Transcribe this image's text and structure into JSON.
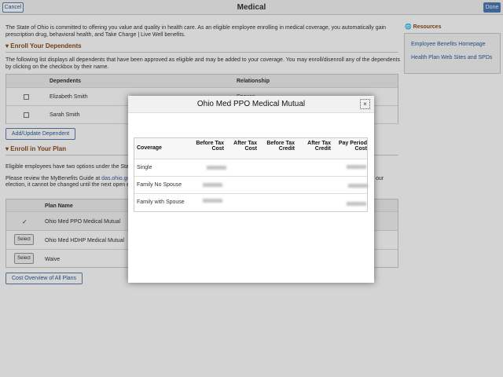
{
  "header": {
    "title": "Medical",
    "cancel": "Cancel",
    "done": "Done"
  },
  "intro": [
    "The State of Ohio is committed to offering you value and quality in health care. As an eligible employee enrolling in medical coverage, you automatically gain",
    "prescription drug, behavioral health, and Take Charge | Live Well benefits."
  ],
  "dependents": {
    "section": "Enroll Your Dependents",
    "desc": [
      "The following list displays all dependents that have been approved as eligible and may be added to your coverage. You may enroll/disenroll any of the dependents",
      "by clicking on the checkbox by their name."
    ],
    "col_dependents": "Dependents",
    "col_relationship": "Relationship",
    "rows": [
      {
        "name": "Elizabeth Smith",
        "relationship": "Spouse"
      },
      {
        "name": "Sarah Smith",
        "relationship": ""
      }
    ],
    "add_button": "Add/Update Dependent"
  },
  "plan": {
    "section": "Enroll in Your Plan",
    "p1": "Eligible employees have two options under the Stat",
    "p2a": "Please review the MyBenefits Guide at ",
    "p2link": "das.ohio.go",
    "p2end": "our",
    "p3": "election, it cannot be changed until the next open e",
    "col_plan": "Plan Name",
    "rows": [
      {
        "action": "✓",
        "name": "Ohio Med PPO Medical Mutual"
      },
      {
        "action": "Select",
        "name": "Ohio Med HDHP Medical Mutual"
      },
      {
        "action": "Select",
        "name": "Waive"
      }
    ],
    "cost_button": "Cost Overview of All Plans"
  },
  "resources": {
    "title": "Resources",
    "links": [
      "Employee Benefits Homepage",
      "Health Plan Web Sites and SPDs"
    ]
  },
  "modal": {
    "title": "Ohio Med PPO Medical Mutual",
    "close": "×",
    "columns": [
      "Coverage",
      "Before Tax Cost",
      "After Tax Cost",
      "Before Tax Credit",
      "After Tax Credit",
      "Pay Period Cost"
    ],
    "rows": [
      "Single",
      "Family No Spouse",
      "Family with Spouse"
    ]
  }
}
